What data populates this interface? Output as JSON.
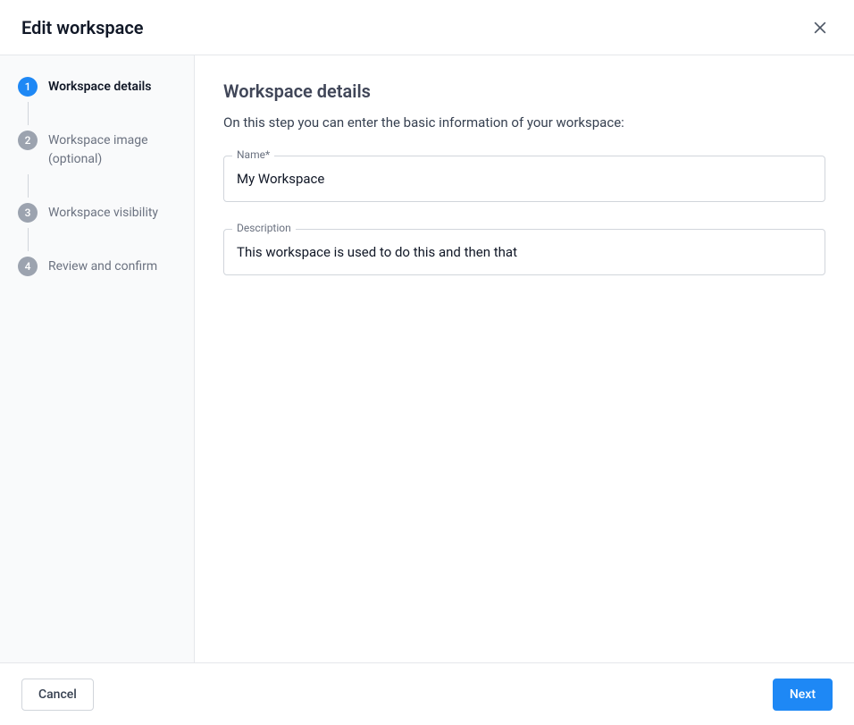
{
  "header": {
    "title": "Edit workspace"
  },
  "stepper": {
    "steps": [
      {
        "number": "1",
        "label": "Workspace details"
      },
      {
        "number": "2",
        "label": "Workspace image (optional)"
      },
      {
        "number": "3",
        "label": "Workspace visibility"
      },
      {
        "number": "4",
        "label": "Review and confirm"
      }
    ]
  },
  "main": {
    "title": "Workspace details",
    "description": "On this step you can enter the basic information of your workspace:",
    "fields": {
      "name": {
        "label": "Name*",
        "value": "My Workspace"
      },
      "description": {
        "label": "Description",
        "value": "This workspace is used to do this and then that"
      }
    }
  },
  "footer": {
    "cancel": "Cancel",
    "next": "Next"
  }
}
